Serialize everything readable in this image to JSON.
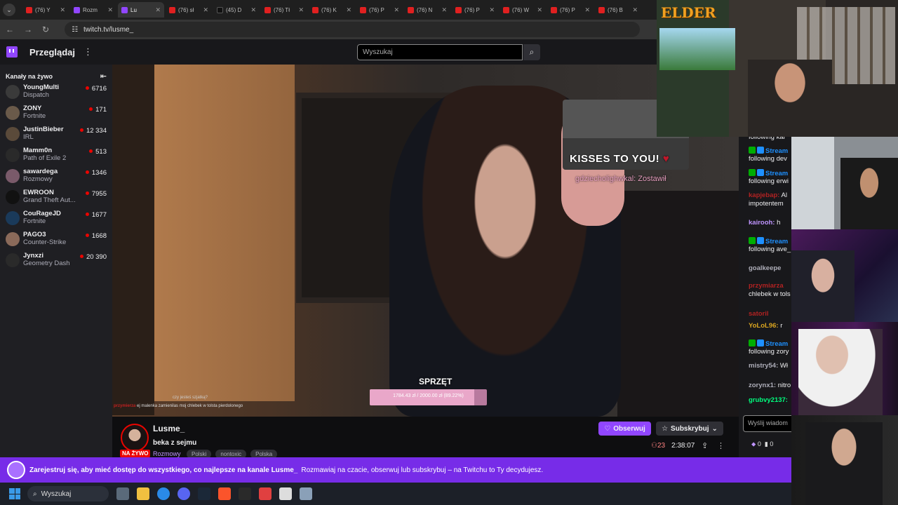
{
  "browser": {
    "tabs": [
      {
        "title": "(76) Y",
        "icon": "youtube-icon",
        "active": false
      },
      {
        "title": "Rozm",
        "icon": "twitch-icon",
        "active": false
      },
      {
        "title": "Lu",
        "icon": "twitch-icon",
        "active": true
      },
      {
        "title": "(76) sł",
        "icon": "youtube-icon",
        "active": false
      },
      {
        "title": "(45) D",
        "icon": "tiktok-icon",
        "active": false
      },
      {
        "title": "(76) Tł",
        "icon": "youtube-icon",
        "active": false
      },
      {
        "title": "(76) K",
        "icon": "youtube-icon",
        "active": false
      },
      {
        "title": "(76) P",
        "icon": "youtube-icon",
        "active": false
      },
      {
        "title": "(76) N",
        "icon": "youtube-icon",
        "active": false
      },
      {
        "title": "(76) P",
        "icon": "youtube-icon",
        "active": false
      },
      {
        "title": "(76) W",
        "icon": "youtube-icon",
        "active": false
      },
      {
        "title": "(76) P",
        "icon": "youtube-icon",
        "active": false
      },
      {
        "title": "(76) B",
        "icon": "youtube-icon",
        "active": false
      }
    ],
    "url": "twitch.tv/lusme_"
  },
  "nav": {
    "browse": "Przeglądaj",
    "search_placeholder": "Wyszukaj"
  },
  "sidebar": {
    "heading": "Kanały na żywo",
    "channels": [
      {
        "name": "YoungMulti",
        "game": "Dispatch",
        "viewers": "6716",
        "color": "#3a3a3a"
      },
      {
        "name": "ZONY",
        "game": "Fortnite",
        "viewers": "171",
        "color": "#6a5a4a"
      },
      {
        "name": "JustinBieber",
        "game": "IRL",
        "viewers": "12 334",
        "color": "#5a4a3a"
      },
      {
        "name": "Mamm0n",
        "game": "Path of Exile 2",
        "viewers": "513",
        "color": "#2a2a2a"
      },
      {
        "name": "sawardega",
        "game": "Rozmowy",
        "viewers": "1346",
        "color": "#7a5a6a"
      },
      {
        "name": "EWROON",
        "game": "Grand Theft Aut...",
        "viewers": "7955",
        "color": "#111111"
      },
      {
        "name": "CouRageJD",
        "game": "Fortnite",
        "viewers": "1677",
        "color": "#1a3a5a"
      },
      {
        "name": "PAGO3",
        "game": "Counter-Strike",
        "viewers": "1668",
        "color": "#8a6a5a"
      },
      {
        "name": "Jynxzi",
        "game": "Geometry Dash",
        "viewers": "20 390",
        "color": "#2a2a2a"
      }
    ]
  },
  "video": {
    "overlay_kisses": "KISSES TO YOU!",
    "overlay_kisses_sub": "gdziecholighwkal: Zostawił",
    "goal_title": "SPRZĘT",
    "goal_text": "1784.43 zł / 2000.00 zł (89.22%)",
    "goal_fraction": 0.8922,
    "overlay_chat_1": "czy jesteś szjatką?",
    "overlay_chat_2_user": "przymierza",
    "overlay_chat_2_text": "ej malenka zamienilas moj chlebek w tolsta pierdolonego"
  },
  "stream": {
    "name": "Lusme_",
    "title": "beka z sejmu",
    "category": "Rozmowy",
    "live": "NA ŻYWO",
    "tags": [
      "Polski",
      "nontoxic",
      "Polska"
    ],
    "follow": "Obserwuj",
    "subscribe": "Subskrybuj",
    "viewers": "23",
    "uptime": "2:38:07"
  },
  "chat": {
    "messages": [
      {
        "user": "",
        "text": "following kai",
        "color": "#efeff1"
      },
      {
        "user": "Stream",
        "text": "",
        "color": "#1e90ff"
      },
      {
        "user": "",
        "text": "following dev",
        "color": "#efeff1"
      },
      {
        "user": "Stream",
        "text": "",
        "color": "#1e90ff"
      },
      {
        "user": "",
        "text": "following erwi",
        "color": "#efeff1"
      },
      {
        "user": "kapjebap:",
        "text": "Al",
        "color": "#b22222"
      },
      {
        "user": "",
        "text": "impotentem",
        "color": "#efeff1"
      },
      {
        "user": "kairooh:",
        "text": "h",
        "color": "#bf94ff"
      },
      {
        "user": "Stream",
        "text": "",
        "color": "#1e90ff"
      },
      {
        "user": "",
        "text": "following ave_",
        "color": "#efeff1"
      },
      {
        "user": "goalkeepe",
        "text": "",
        "color": "#adadb8"
      },
      {
        "user": "przymiarza",
        "text": "",
        "color": "#b22222"
      },
      {
        "user": "",
        "text": "chlebek w tols",
        "color": "#efeff1"
      },
      {
        "user": "satoril",
        "text": "",
        "color": "#b22222"
      },
      {
        "user": "YoLoL96:",
        "text": "r",
        "color": "#daa520"
      },
      {
        "user": "Stream",
        "text": "",
        "color": "#1e90ff"
      },
      {
        "user": "",
        "text": "following zory",
        "color": "#efeff1"
      },
      {
        "user": "mistry54:",
        "text": "Wł",
        "color": "#adadb8"
      },
      {
        "user": "zorynx1:",
        "text": "nitro",
        "color": "#adadb8"
      },
      {
        "user": "grubvy2137:",
        "text": "",
        "color": "#00ff7f"
      }
    ],
    "input_placeholder": "Wyślij wiadom",
    "points": "0",
    "bits": "0"
  },
  "cams": {
    "elder_logo": "ELDER"
  },
  "banner": {
    "bold": "Zarejestruj się, aby mieć dostęp do wszystkiego, co najlepsze na kanale Lusme_",
    "rest": "Rozmawiaj na czacie, obserwuj lub subskrybuj – na Twitchu to Ty decydujesz."
  },
  "taskbar": {
    "search": "Wyszukaj",
    "apps": [
      "explorer-icon",
      "folder-icon",
      "chrome-icon",
      "discord-icon",
      "steam-icon",
      "brave-icon",
      "xbox-icon",
      "app-icon",
      "settings-icon",
      "gear-icon"
    ]
  }
}
